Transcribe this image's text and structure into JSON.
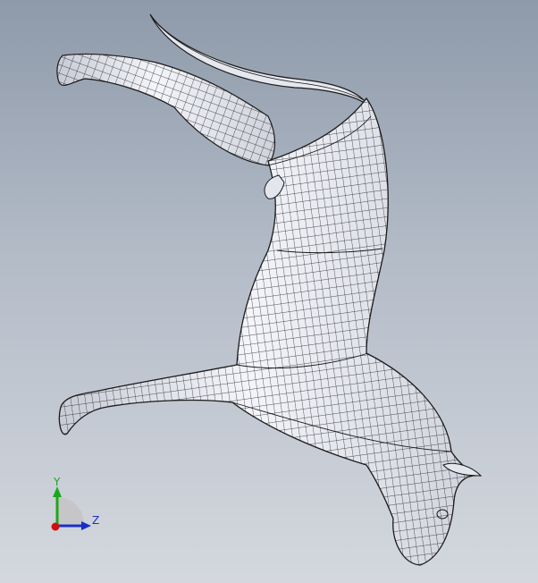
{
  "viewport": {
    "background_top": "#8e9aaa",
    "background_bottom": "#d4d8de",
    "model": {
      "description_icon": "wireframe-horse-icon",
      "surface_color": "#e8eaf2",
      "mesh_line_color": "#1a1a1a"
    }
  },
  "triad": {
    "y_label": "Y",
    "z_label": "Z",
    "y_color": "#1aa81a",
    "z_color": "#1a2fc8",
    "x_color": "#d01010"
  }
}
